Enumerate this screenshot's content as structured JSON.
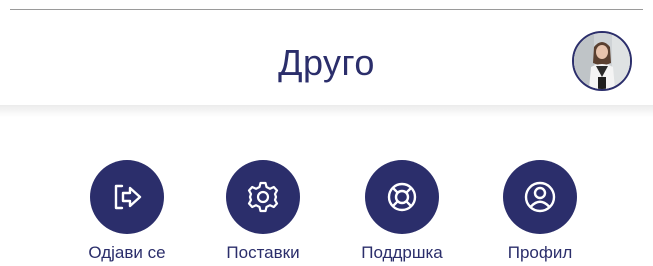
{
  "header": {
    "title": "Друго",
    "avatar_icon": "user-avatar-photo"
  },
  "actions": [
    {
      "label": "Одјави се",
      "icon": "logout-icon"
    },
    {
      "label": "Поставки",
      "icon": "gear-icon"
    },
    {
      "label": "Поддршка",
      "icon": "lifebuoy-icon"
    },
    {
      "label": "Профил",
      "icon": "profile-icon"
    }
  ],
  "colors": {
    "primary": "#2b2e6b",
    "background": "#ffffff"
  }
}
